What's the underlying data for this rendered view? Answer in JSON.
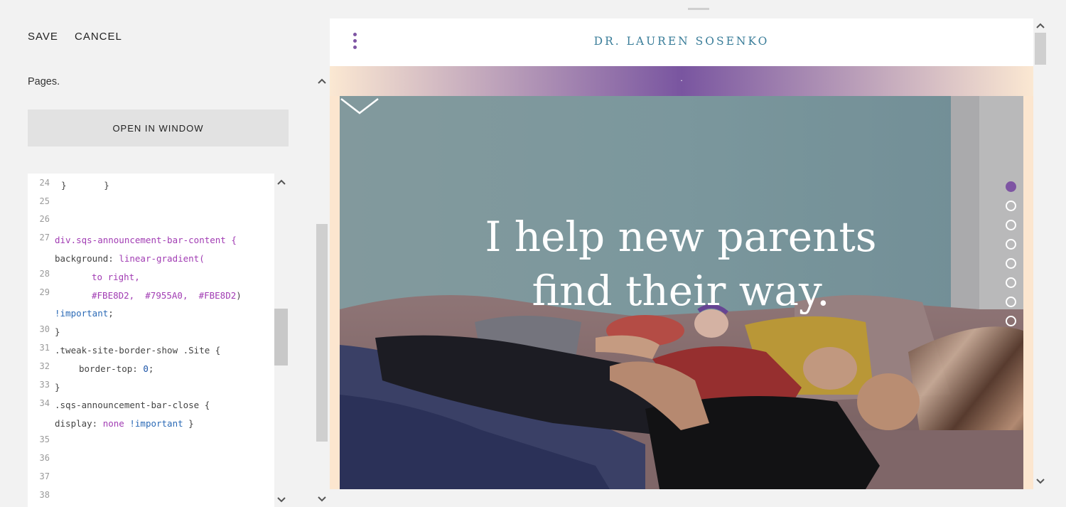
{
  "toolbar": {
    "save_label": "SAVE",
    "cancel_label": "CANCEL"
  },
  "panel": {
    "pages_label": "Pages.",
    "open_window_label": "OPEN IN WINDOW"
  },
  "code": {
    "line_numbers": [
      "24",
      "25",
      "26",
      "27",
      "28",
      "29",
      "30",
      "31",
      "32",
      "33",
      "34",
      "35",
      "36",
      "37",
      "38"
    ],
    "lines": {
      "l24": "}       }",
      "l27_selector": "div.sqs-announcement-bar-content {",
      "l27b_prop": "background: ",
      "l27b_val": "linear-gradient(",
      "l28": "to right,",
      "l29_c1": "#FBE8D2,",
      "l29_c2": "#7955A0,",
      "l29_c3": "#FBE8D2",
      "l29_close": ")",
      "l29b_imp": "!important",
      "l29b_semi": ";",
      "l30": "}",
      "l31": ".tweak-site-border-show .Site {",
      "l32_prop": "border-top: ",
      "l32_val": "0",
      "l32_semi": ";",
      "l33": "}",
      "l34": ".sqs-announcement-bar-close {",
      "l34b_prop": "display: ",
      "l34b_val": "none",
      "l34b_imp": "!important",
      "l34b_close": " }"
    }
  },
  "preview": {
    "site_title": "DR. LAUREN SOSENKO",
    "announcement_text": ".",
    "announcement_gradient": [
      "#FBE8D2",
      "#7955A0",
      "#FBE8D2"
    ],
    "hero_line1": "I help new parents",
    "hero_line2": "find their way.",
    "section_dots": 8,
    "active_dot": 0
  },
  "colors": {
    "accent": "#7e55a3",
    "title": "#3a7d99"
  },
  "icons": [
    "menu-icon",
    "chevron-up-icon",
    "chevron-down-icon",
    "scroll-down-arrow-icon"
  ]
}
